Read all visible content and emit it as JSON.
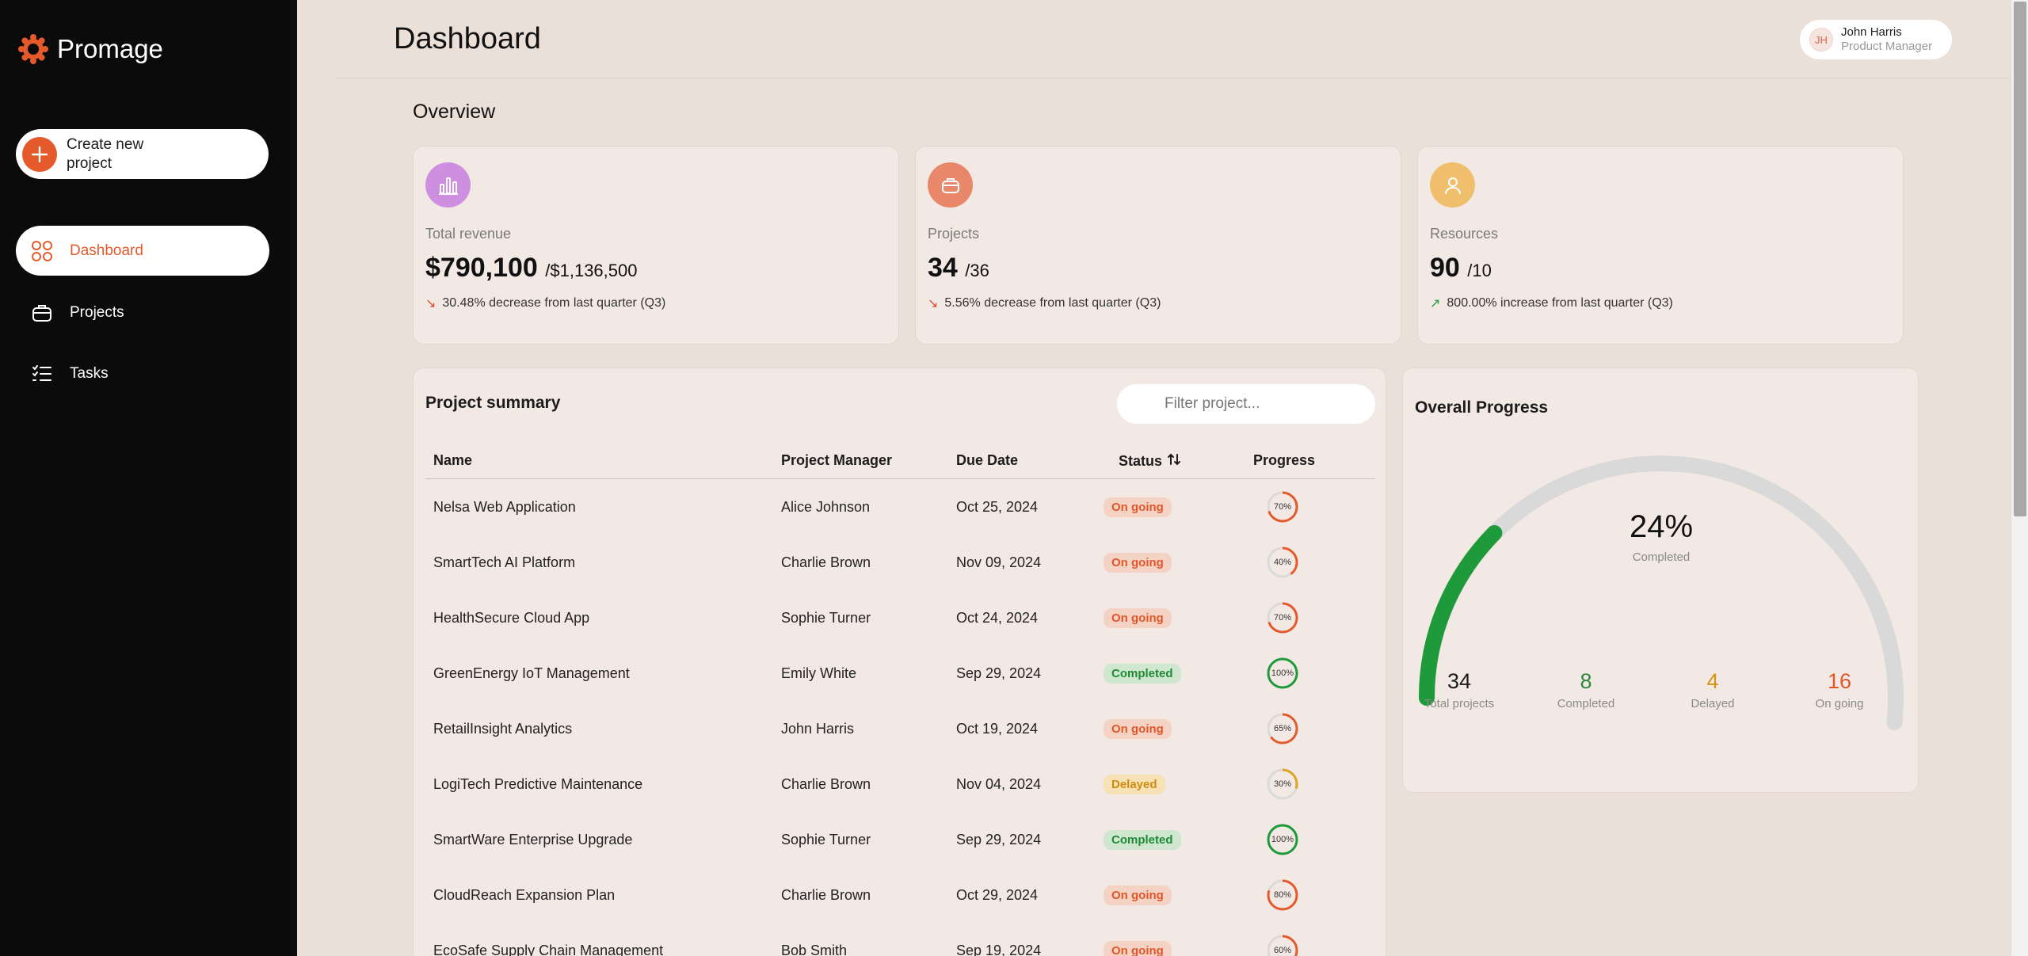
{
  "brand": {
    "name": "Promage"
  },
  "sidebar": {
    "create_label": "Create new project",
    "items": [
      {
        "label": "Dashboard",
        "icon": "grid-icon",
        "active": true
      },
      {
        "label": "Projects",
        "icon": "briefcase-icon",
        "active": false
      },
      {
        "label": "Tasks",
        "icon": "checklist-icon",
        "active": false
      }
    ]
  },
  "header": {
    "title": "Dashboard",
    "user": {
      "initials": "JH",
      "name": "John Harris",
      "role": "Product Manager"
    }
  },
  "overview": {
    "title": "Overview",
    "cards": [
      {
        "label": "Total revenue",
        "value": "$790,100",
        "of": "/$1,136,500",
        "change": "30.48% decrease from last quarter (Q3)",
        "trend": "down",
        "icon": "bar-chart-icon",
        "icon_color": "#cf8fe0"
      },
      {
        "label": "Projects",
        "value": "34",
        "of": "/36",
        "change": "5.56% decrease from last quarter (Q3)",
        "trend": "down",
        "icon": "briefcase-icon",
        "icon_color": "#e8876a"
      },
      {
        "label": "Resources",
        "value": "90",
        "of": "/10",
        "change": "800.00% increase from last quarter (Q3)",
        "trend": "up",
        "icon": "user-icon",
        "icon_color": "#efbf6e"
      }
    ]
  },
  "summary": {
    "title": "Project summary",
    "filter_placeholder": "Filter project...",
    "columns": {
      "name": "Name",
      "manager": "Project Manager",
      "due": "Due Date",
      "status": "Status",
      "progress": "Progress"
    },
    "rows": [
      {
        "name": "Nelsa Web Application",
        "manager": "Alice Johnson",
        "due": "Oct 25, 2024",
        "status": "On going",
        "progress": 70
      },
      {
        "name": "SmartTech AI Platform",
        "manager": "Charlie Brown",
        "due": "Nov 09, 2024",
        "status": "On going",
        "progress": 40
      },
      {
        "name": "HealthSecure Cloud App",
        "manager": "Sophie Turner",
        "due": "Oct 24, 2024",
        "status": "On going",
        "progress": 70
      },
      {
        "name": "GreenEnergy IoT Management",
        "manager": "Emily White",
        "due": "Sep 29, 2024",
        "status": "Completed",
        "progress": 100
      },
      {
        "name": "RetailInsight Analytics",
        "manager": "John Harris",
        "due": "Oct 19, 2024",
        "status": "On going",
        "progress": 65
      },
      {
        "name": "LogiTech Predictive Maintenance",
        "manager": "Charlie Brown",
        "due": "Nov 04, 2024",
        "status": "Delayed",
        "progress": 30
      },
      {
        "name": "SmartWare Enterprise Upgrade",
        "manager": "Sophie Turner",
        "due": "Sep 29, 2024",
        "status": "Completed",
        "progress": 100
      },
      {
        "name": "CloudReach Expansion Plan",
        "manager": "Charlie Brown",
        "due": "Oct 29, 2024",
        "status": "On going",
        "progress": 80
      },
      {
        "name": "EcoSafe Supply Chain Management",
        "manager": "Bob Smith",
        "due": "Sep 19, 2024",
        "status": "On going",
        "progress": 60
      }
    ]
  },
  "overall": {
    "title": "Overall Progress",
    "percent": 24,
    "percent_label": "24%",
    "completed_label": "Completed",
    "stats": [
      {
        "value": "34",
        "label": "Total projects",
        "color": "#1c1c1c"
      },
      {
        "value": "8",
        "label": "Completed",
        "color": "#2b8a3e"
      },
      {
        "value": "4",
        "label": "Delayed",
        "color": "#d69315"
      },
      {
        "value": "16",
        "label": "On going",
        "color": "#e2562a"
      }
    ]
  },
  "colors": {
    "accent": "#e55a2b",
    "completed": "#1f9a3a",
    "delayed": "#e0a323",
    "track": "#d9d9d9"
  }
}
